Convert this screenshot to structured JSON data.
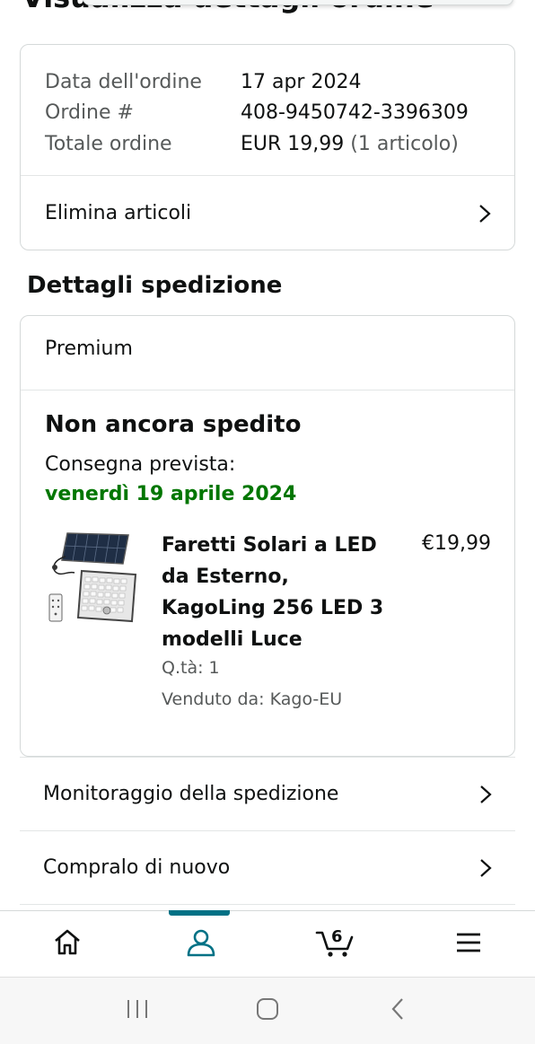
{
  "header": {
    "title": "Visualizza dettagli ordine"
  },
  "order_summary": {
    "rows": [
      {
        "label": "Data dell'ordine",
        "value": "17 apr 2024"
      },
      {
        "label": "Ordine #",
        "value": "408-9450742-3396309"
      },
      {
        "label": "Totale ordine",
        "value": "EUR 19,99",
        "extra": "(1 articolo)"
      }
    ],
    "delete_items_label": "Elimina articoli"
  },
  "shipment": {
    "section_title": "Dettagli spedizione",
    "plan": "Premium",
    "status": "Non ancora spedito",
    "delivery_label": "Consegna prevista:",
    "delivery_date": "venerdì 19 aprile 2024",
    "delivery_color": "#007600",
    "product": {
      "name": "Faretti Solari a LED da Esterno, KagoLing 256 LED 3 modelli Luce",
      "price": "€19,99",
      "quantity": "Q.tà: 1",
      "seller": "Venduto da: Kago-EU"
    }
  },
  "actions": [
    {
      "label": "Monitoraggio della spedizione"
    },
    {
      "label": "Compralo di nuovo"
    }
  ],
  "bottom_nav": {
    "items": [
      {
        "icon": "home-icon"
      },
      {
        "icon": "account-icon",
        "active": true
      },
      {
        "icon": "cart-icon",
        "count": "6"
      },
      {
        "icon": "menu-icon"
      }
    ],
    "accent_color": "#007185"
  },
  "system_nav": {
    "items": [
      "recents-icon",
      "home-button-icon",
      "back-icon"
    ]
  }
}
